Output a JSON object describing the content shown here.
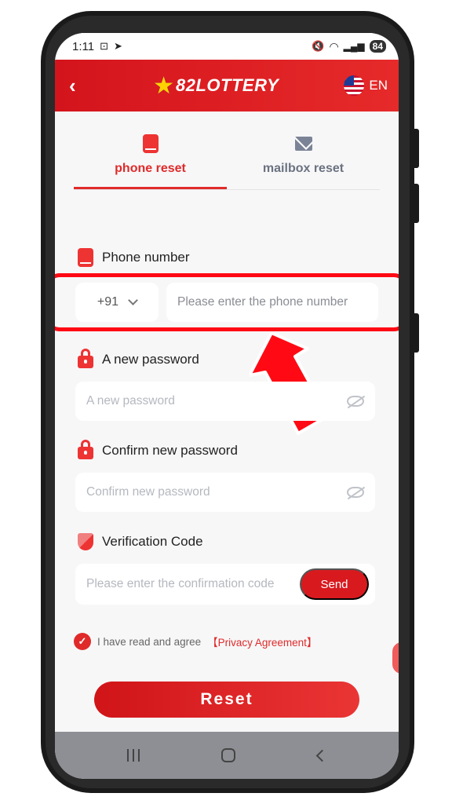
{
  "status_bar": {
    "time": "1:11",
    "battery": "84"
  },
  "header": {
    "back_icon": "chevron-left-icon",
    "logo_text": "82LOTTERY",
    "language": "EN"
  },
  "tabs": [
    {
      "label": "phone reset",
      "icon": "phone-icon",
      "active": true
    },
    {
      "label": "mailbox reset",
      "icon": "mail-icon",
      "active": false
    }
  ],
  "form": {
    "phone": {
      "label": "Phone number",
      "country_code": "+91",
      "placeholder": "Please enter the phone number"
    },
    "new_password": {
      "label": "A new password",
      "placeholder": "A new password"
    },
    "confirm_password": {
      "label": "Confirm new password",
      "placeholder": "Confirm new password"
    },
    "verification": {
      "label": "Verification Code",
      "placeholder": "Please enter the confirmation code",
      "send_label": "Send"
    }
  },
  "agreement": {
    "text": "I have read and agree",
    "link": "【Privacy Agreement】",
    "checked": true
  },
  "reset_button": "Reset",
  "colors": {
    "brand_red": "#e02a2a",
    "highlight_red": "#ff0a14",
    "background": "#f7f7f8"
  }
}
